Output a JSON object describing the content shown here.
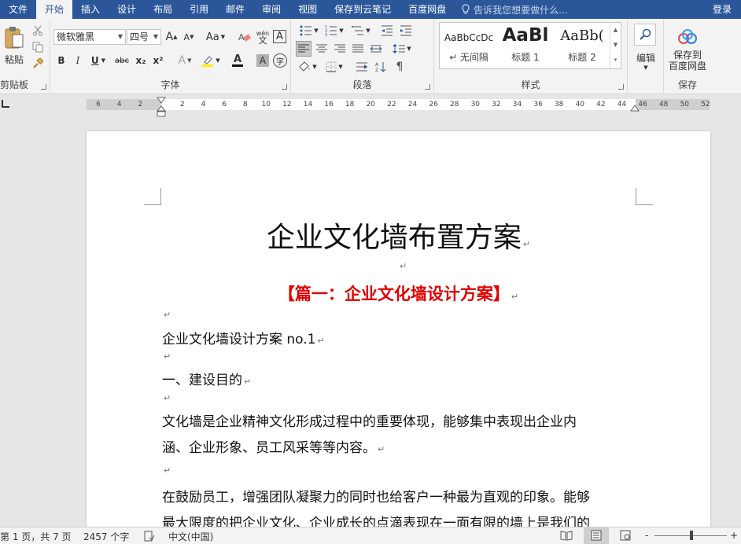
{
  "tabs": [
    "文件",
    "开始",
    "插入",
    "设计",
    "布局",
    "引用",
    "邮件",
    "审阅",
    "视图",
    "保存到云笔记",
    "百度网盘"
  ],
  "active_tab": "开始",
  "tell_me": "告诉我您想要做什么...",
  "login": "登录",
  "clipboard": {
    "paste": "粘贴",
    "label": "剪贴板"
  },
  "font": {
    "name": "微软雅黑",
    "size": "四号",
    "label": "字体",
    "buttons": {
      "grow": "A",
      "shrink": "A",
      "case": "Aa",
      "phonetic": "wén",
      "border": "A",
      "bold": "B",
      "italic": "I",
      "underline": "U",
      "strike": "abc",
      "sub": "x₂",
      "sup": "x²",
      "effects": "A",
      "color": "A",
      "shading": "A",
      "enclose": "字"
    }
  },
  "paragraph": {
    "label": "段落"
  },
  "styles": {
    "label": "样式",
    "items": [
      {
        "sample": "AaBbCcDc",
        "name": "↵ 无间隔"
      },
      {
        "sample": "AaBl",
        "name": "标题 1"
      },
      {
        "sample": "AaBb(",
        "name": "标题 2"
      }
    ]
  },
  "editing": {
    "label": "编辑"
  },
  "save": {
    "button": "保存到百度网盘",
    "button_line1": "保存到",
    "button_line2": "百度网盘",
    "label": "保存"
  },
  "ruler": {
    "ticks": [
      "6",
      "4",
      "2",
      "2",
      "4",
      "6",
      "8",
      "10",
      "12",
      "14",
      "16",
      "18",
      "20",
      "22",
      "24",
      "26",
      "28",
      "30",
      "32",
      "34",
      "36",
      "38",
      "40",
      "42",
      "44",
      "46",
      "48",
      "50",
      "52"
    ]
  },
  "document": {
    "title": "企业文化墙布置方案",
    "subtitle": "【篇一：企业文化墙设计方案】",
    "para_mark": "↵",
    "lines": [
      "企业文化墙设计方案 no.1",
      " 一、建设目的",
      " 文化墙是企业精神文化形成过程中的重要体现，能够集中表现出企业内",
      "涵、企业形象、员工风采等等内容。",
      "在鼓励员工，增强团队凝聚力的同时也给客户一种最为直观的印象。能够",
      "最大限度的把企业文化、企业成长的点滴表现在一面有限的墙上是我们的"
    ]
  },
  "status": {
    "page": "第 1 页，共 7 页",
    "words": "2457 个字",
    "lang": "中文(中国)",
    "zoom_minus": "-",
    "zoom_plus": "+"
  }
}
